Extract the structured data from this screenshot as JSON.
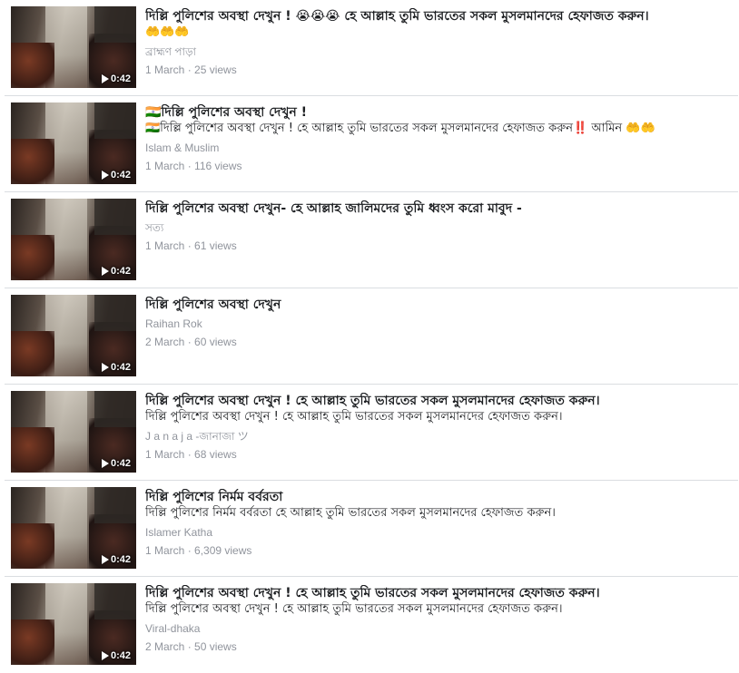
{
  "videos": [
    {
      "title": "দিল্লি পুলিশের অবস্থা দেখুন ! 😭😭😭 হে আল্লাহ তুমি ভারতের সকল মুসলমানদের হেফাজত করুন।",
      "description": "🤲🤲🤲",
      "channel": "ব্রাহ্মণ পাড়া",
      "date": "1 March",
      "views": "25 views",
      "duration": "0:42"
    },
    {
      "title": "🇮🇳দিল্লি পুলিশের অবস্থা দেখুন !",
      "description": "🇮🇳দিল্লি পুলিশের অবস্থা দেখুন ! হে আল্লাহ তুমি ভারতের সকল মুসলমানদের হেফাজত করুন‼️ আমিন 🤲🤲",
      "channel": "Islam & Muslim",
      "date": "1 March",
      "views": "116 views",
      "duration": "0:42"
    },
    {
      "title": "দিল্লি পুলিশের অবস্থা দেখুন- হে আল্লাহ জালিমদের তুমি ধ্বংস করো মাবুদ -",
      "description": "",
      "channel": "সত্য",
      "date": "1 March",
      "views": "61 views",
      "duration": "0:42"
    },
    {
      "title": "দিল্লি পুলিশের অবস্থা দেখুন",
      "description": "",
      "channel": "Raihan Rok",
      "date": "2 March",
      "views": "60 views",
      "duration": "0:42"
    },
    {
      "title": "দিল্লি পুলিশের অবস্থা দেখুন ! হে আল্লাহ তুমি ভারতের সকল মুসলমানদের হেফাজত করুন।",
      "description": "দিল্লি পুলিশের অবস্থা দেখুন ! হে আল্লাহ তুমি ভারতের সকল মুসলমানদের হেফাজত করুন।",
      "channel": "J a n a j a -জানাজা ツ",
      "date": "1 March",
      "views": "68 views",
      "duration": "0:42"
    },
    {
      "title": "দিল্লি পুলিশের নির্মম বর্বরতা",
      "description": "দিল্লি পুলিশের নির্মম বর্বরতা হে আল্লাহ তুমি ভারতের সকল মুসলমানদের হেফাজত করুন।",
      "channel": "Islamer Katha",
      "date": "1 March",
      "views": "6,309 views",
      "duration": "0:42"
    },
    {
      "title": "দিল্লি পুলিশের অবস্থা দেখুন ! হে আল্লাহ তুমি ভারতের সকল মুসলমানদের হেফাজত করুন।",
      "description": "দিল্লি পুলিশের অবস্থা দেখুন ! হে আল্লাহ তুমি ভারতের সকল মুসলমানদের হেফাজত করুন।",
      "channel": "Viral-dhaka",
      "date": "2 March",
      "views": "50 views",
      "duration": "0:42"
    }
  ],
  "separator": " · "
}
